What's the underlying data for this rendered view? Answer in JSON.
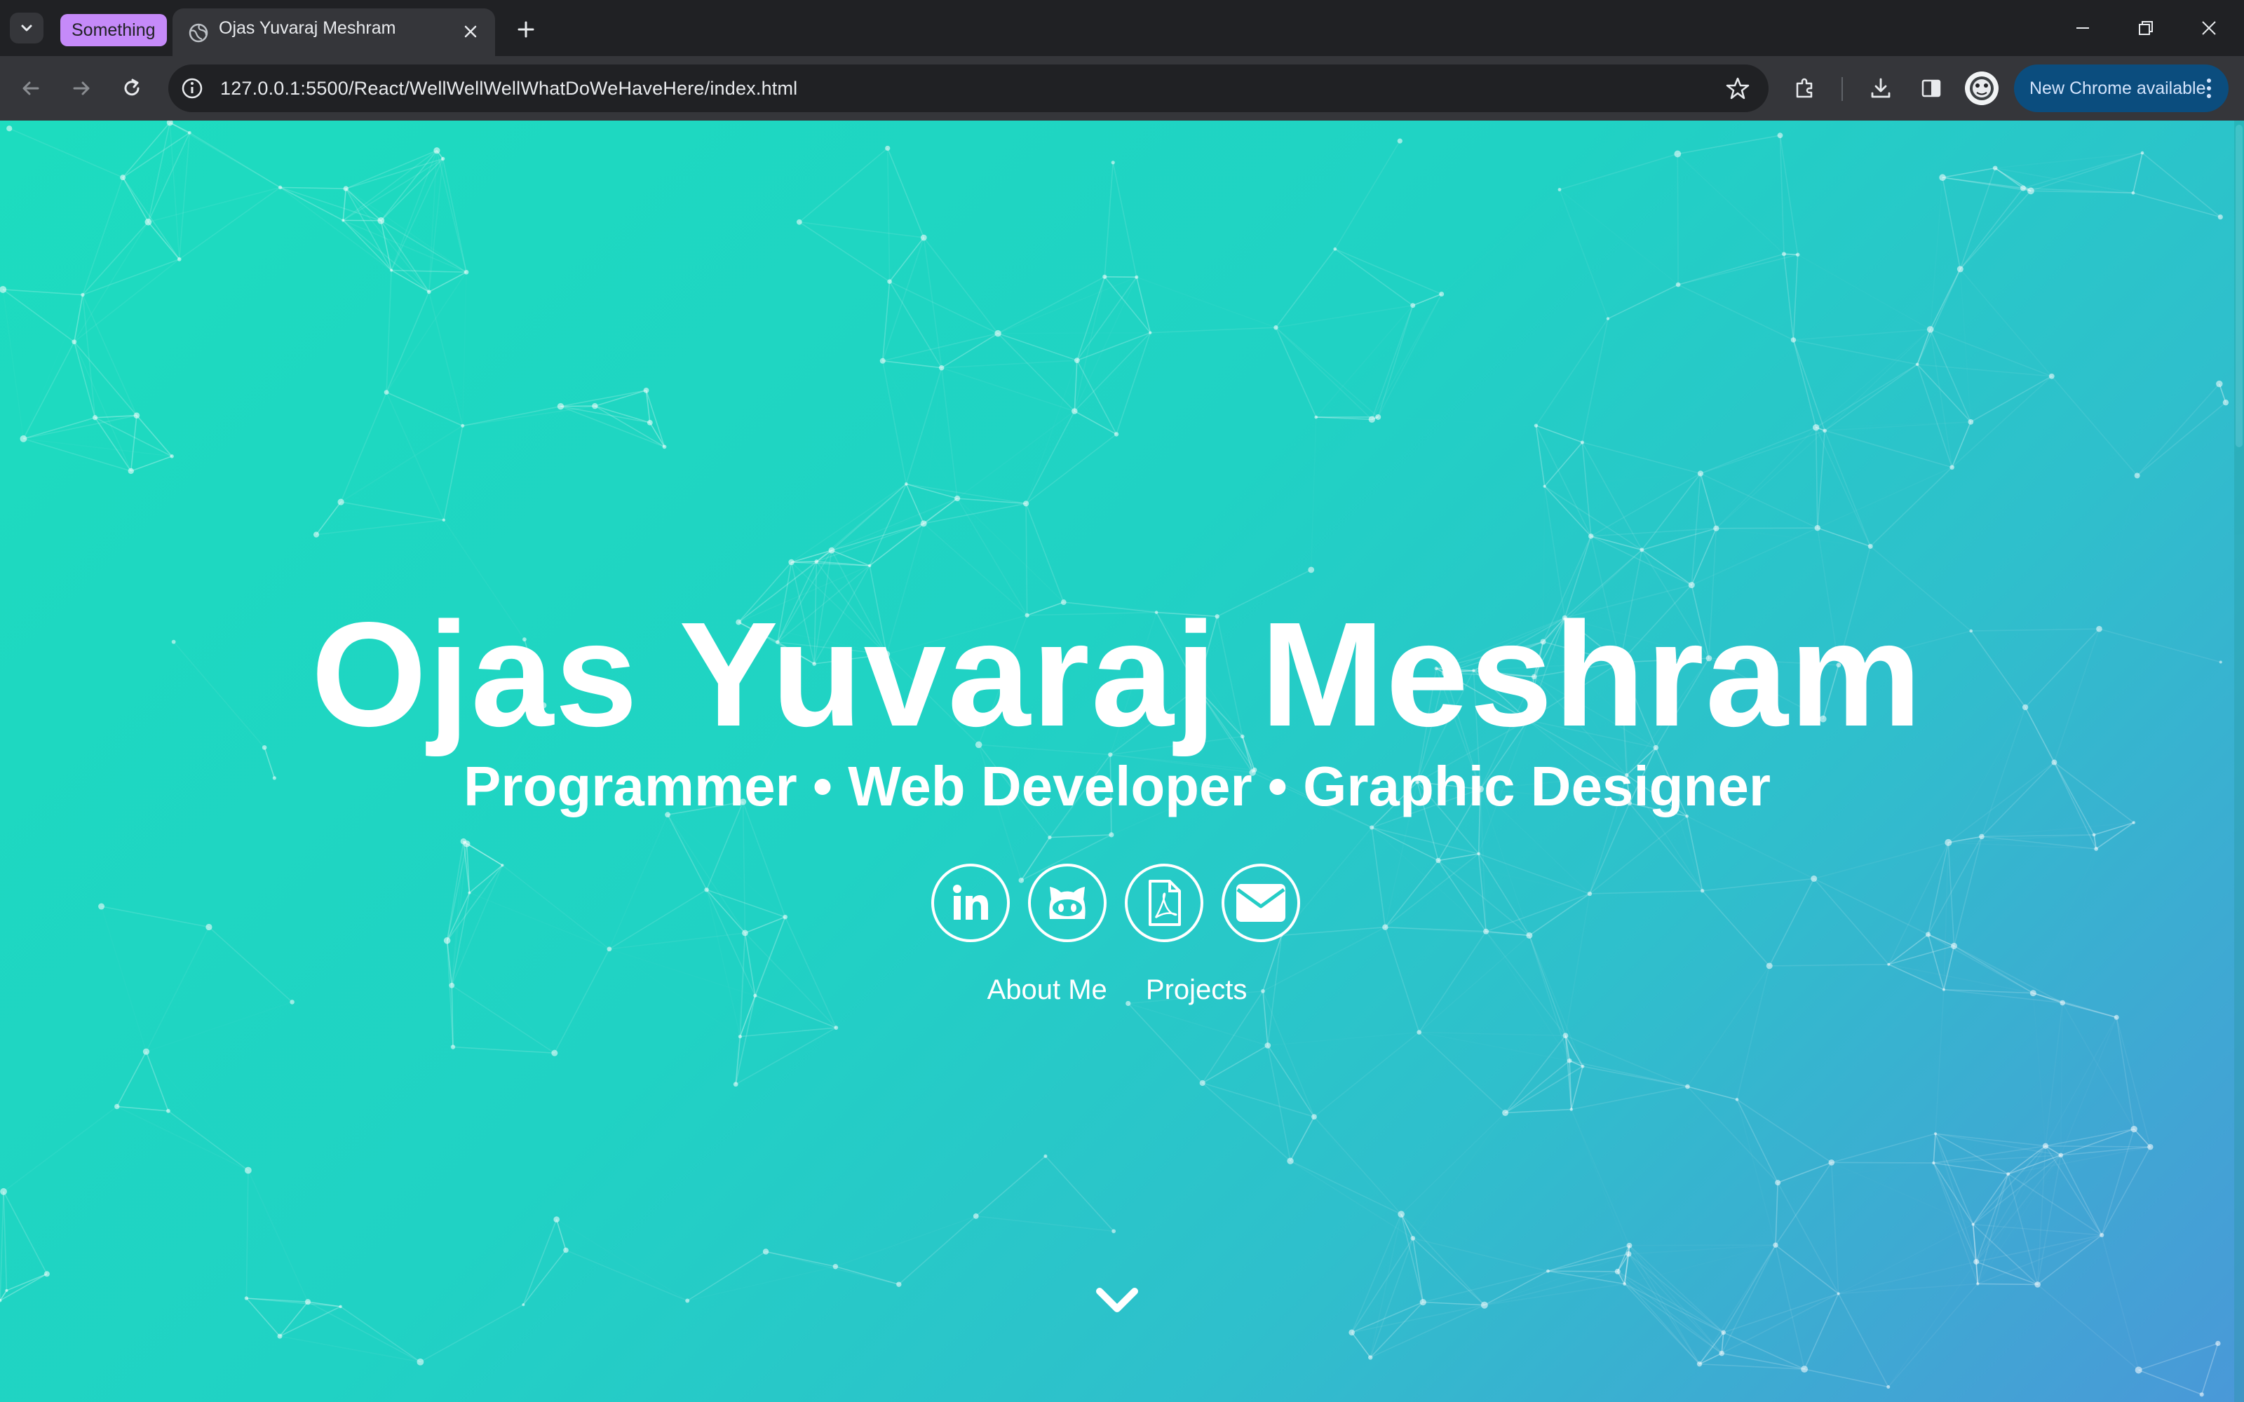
{
  "browser": {
    "tab_group_label": "Something",
    "tab_title": "Ojas Yuvaraj Meshram",
    "url": "127.0.0.1:5500/React/WellWellWellWhatDoWeHaveHere/index.html",
    "update_label": "New Chrome available"
  },
  "page": {
    "name": "Ojas Yuvaraj Meshram",
    "subtitle": "Programmer • Web Developer • Graphic Designer",
    "socials": [
      "linkedin-icon",
      "github-icon",
      "pdf-resume-icon",
      "email-icon"
    ],
    "nav": {
      "about": "About Me",
      "projects": "Projects"
    }
  },
  "theme": {
    "gradient_start": "#1ddcbf",
    "gradient_end": "#4a98d8",
    "text": "#ffffff"
  }
}
